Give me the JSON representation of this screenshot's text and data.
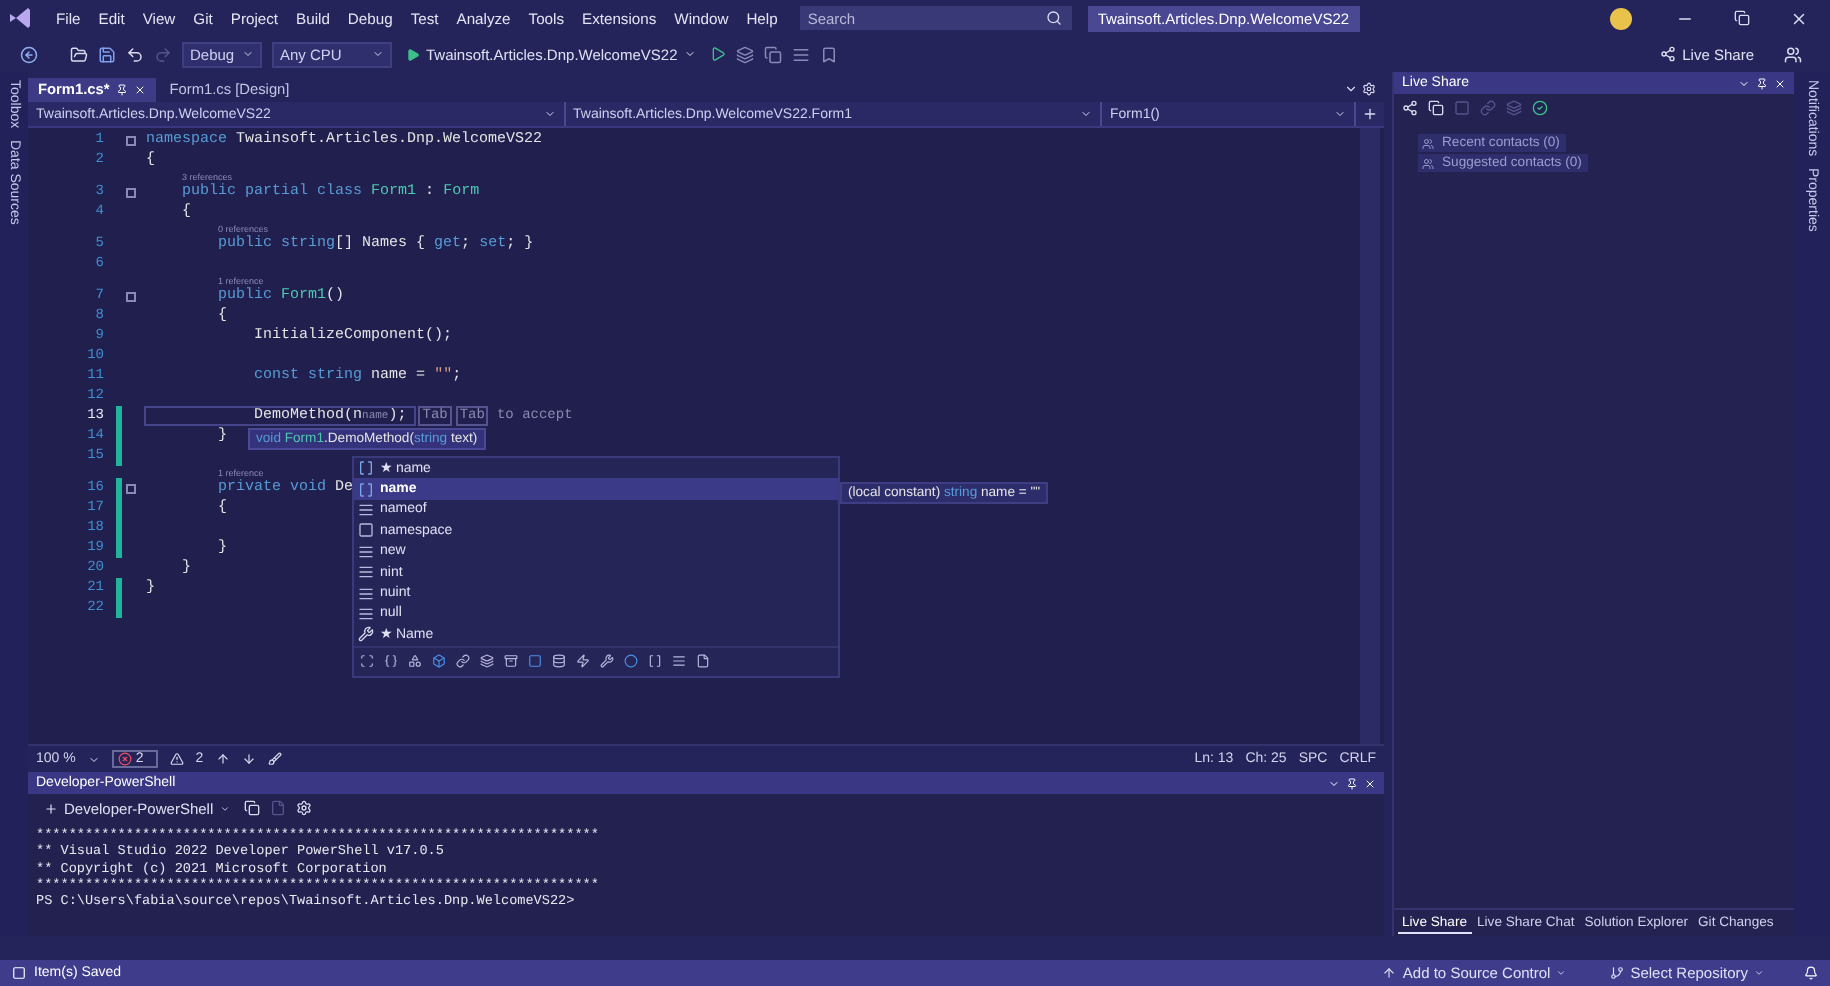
{
  "menu_bar": {
    "items": [
      "File",
      "Edit",
      "View",
      "Git",
      "Project",
      "Build",
      "Debug",
      "Test",
      "Analyze",
      "Tools",
      "Extensions",
      "Window",
      "Help"
    ],
    "search": {
      "placeholder": "Search"
    },
    "solution_name": "Twainsoft.Articles.Dnp.WelcomeVS22"
  },
  "toolbar": {
    "configuration": "Debug",
    "platform": "Any CPU",
    "start_target": "Twainsoft.Articles.Dnp.WelcomeVS22",
    "live_share": "Live Share"
  },
  "side_tabs_left": [
    "Toolbox",
    "Data Sources"
  ],
  "side_tabs_right": [
    "Notifications",
    "Properties"
  ],
  "document_tabs": [
    {
      "label": "Form1.cs*",
      "selected": true
    },
    {
      "label": "Form1.cs [Design]",
      "selected": false
    }
  ],
  "navigation_bar": [
    "Twainsoft.Articles.Dnp.WelcomeVS22",
    "Twainsoft.Articles.Dnp.WelcomeVS22.Form1",
    "Form1()"
  ],
  "code": {
    "lines": [
      {
        "number": "1",
        "collapsible": true,
        "changed": false,
        "current": false,
        "tokens": [
          {
            "text": "namespace",
            "kind": "keyword"
          },
          {
            "text": " Twainsoft.Articles.Dnp.WelcomeVS22",
            "kind": "plain"
          }
        ]
      },
      {
        "number": "2",
        "collapsible": false,
        "changed": false,
        "current": false,
        "tokens": [
          {
            "text": "{",
            "kind": "plain"
          }
        ]
      },
      {
        "number": "3",
        "lens": "3 references",
        "collapsible": true,
        "changed": false,
        "current": false,
        "tokens": [
          {
            "text": "    public partial class ",
            "kind": "keyword"
          },
          {
            "text": "Form1",
            "kind": "type"
          },
          {
            "text": " : ",
            "kind": "plain"
          },
          {
            "text": "Form",
            "kind": "type"
          }
        ]
      },
      {
        "number": "4",
        "collapsible": false,
        "changed": false,
        "current": false,
        "tokens": [
          {
            "text": "    {",
            "kind": "plain"
          }
        ]
      },
      {
        "number": "5",
        "lens": "0 references",
        "collapsible": false,
        "changed": false,
        "current": false,
        "tokens": [
          {
            "text": "        public string",
            "kind": "keyword"
          },
          {
            "text": "[] Names { ",
            "kind": "plain"
          },
          {
            "text": "get",
            "kind": "keyword"
          },
          {
            "text": "; ",
            "kind": "plain"
          },
          {
            "text": "set",
            "kind": "keyword"
          },
          {
            "text": "; }",
            "kind": "plain"
          }
        ]
      },
      {
        "number": "6",
        "collapsible": false,
        "changed": false,
        "current": false
      },
      {
        "number": "7",
        "lens": "1 reference",
        "collapsible": true,
        "changed": false,
        "current": false,
        "tokens": [
          {
            "text": "        public ",
            "kind": "keyword"
          },
          {
            "text": "Form1",
            "kind": "type"
          },
          {
            "text": "()",
            "kind": "plain"
          }
        ]
      },
      {
        "number": "8",
        "collapsible": false,
        "changed": false,
        "current": false,
        "tokens": [
          {
            "text": "        {",
            "kind": "plain"
          }
        ]
      },
      {
        "number": "9",
        "collapsible": false,
        "changed": false,
        "current": false,
        "tokens": [
          {
            "text": "            InitializeComponent();",
            "kind": "plain"
          }
        ]
      },
      {
        "number": "10",
        "collapsible": false,
        "changed": false,
        "current": false
      },
      {
        "number": "11",
        "collapsible": false,
        "changed": false,
        "current": false,
        "tokens": [
          {
            "text": "            const string ",
            "kind": "keyword"
          },
          {
            "text": "name",
            "kind": "plain"
          },
          {
            "text": " = ",
            "kind": "plain"
          },
          {
            "text": "\"\"",
            "kind": "string"
          },
          {
            "text": ";",
            "kind": "plain"
          }
        ]
      },
      {
        "number": "12",
        "collapsible": false,
        "changed": false,
        "current": false
      },
      {
        "number": "13",
        "collapsible": false,
        "changed": true,
        "current": true,
        "tokens": [
          {
            "text": "            DemoMethod(n",
            "kind": "plain"
          },
          {
            "text": "name",
            "kind": "ghost"
          },
          {
            "text": ");",
            "kind": "plain"
          }
        ],
        "hints": [
          {
            "text": "Tab",
            "kind": "key"
          },
          {
            "text": "Tab",
            "kind": "key"
          },
          {
            "text": "to accept",
            "kind": "note"
          }
        ]
      },
      {
        "number": "14",
        "collapsible": false,
        "changed": true,
        "current": false,
        "tokens": [
          {
            "text": "        }",
            "kind": "plain"
          }
        ]
      },
      {
        "number": "15",
        "collapsible": false,
        "changed": true,
        "current": false
      },
      {
        "number": "16",
        "lens": "1 reference",
        "collapsible": true,
        "changed": true,
        "current": false,
        "tokens": [
          {
            "text": "        private void ",
            "kind": "keyword"
          },
          {
            "text": "De",
            "kind": "plain"
          }
        ]
      },
      {
        "number": "17",
        "collapsible": false,
        "changed": true,
        "current": false,
        "tokens": [
          {
            "text": "        {",
            "kind": "plain"
          }
        ]
      },
      {
        "number": "18",
        "collapsible": false,
        "changed": true,
        "current": false
      },
      {
        "number": "19",
        "collapsible": false,
        "changed": true,
        "current": false,
        "tokens": [
          {
            "text": "        }",
            "kind": "plain"
          }
        ]
      },
      {
        "number": "20",
        "collapsible": false,
        "changed": false,
        "current": false,
        "tokens": [
          {
            "text": "    }",
            "kind": "plain"
          }
        ]
      },
      {
        "number": "21",
        "collapsible": false,
        "changed": true,
        "current": false,
        "tokens": [
          {
            "text": "}",
            "kind": "plain"
          }
        ]
      },
      {
        "number": "22",
        "collapsible": false,
        "changed": true,
        "current": false
      }
    ]
  },
  "signature_help": [
    {
      "text": "void ",
      "kind": "keyword"
    },
    {
      "text": "Form1",
      "kind": "type"
    },
    {
      "text": ".DemoMethod(",
      "kind": "plain"
    },
    {
      "text": "string",
      "kind": "keyword"
    },
    {
      "text": " text)",
      "kind": "plain"
    }
  ],
  "completion": {
    "items": [
      {
        "label": "★ name",
        "kind": "field",
        "selected": false
      },
      {
        "label": "name",
        "kind": "field",
        "selected": true
      },
      {
        "label": "nameof",
        "kind": "keyword",
        "selected": false
      },
      {
        "label": "namespace",
        "kind": "snippet",
        "selected": false
      },
      {
        "label": "new",
        "kind": "keyword",
        "selected": false
      },
      {
        "label": "nint",
        "kind": "keyword",
        "selected": false
      },
      {
        "label": "nuint",
        "kind": "keyword",
        "selected": false
      },
      {
        "label": "null",
        "kind": "keyword",
        "selected": false
      },
      {
        "label": "★ Name",
        "kind": "property",
        "selected": false
      }
    ],
    "tooltip": [
      {
        "text": "(local constant) ",
        "kind": "plain"
      },
      {
        "text": "string",
        "kind": "keyword"
      },
      {
        "text": " name = \"\"",
        "kind": "plain"
      }
    ]
  },
  "editor_status": {
    "zoom": "100 %",
    "errors": "2",
    "warnings": "2",
    "line": "Ln: 13",
    "column": "Ch: 25",
    "indent": "SPC",
    "line_ending": "CRLF"
  },
  "terminal": {
    "title": "Developer-PowerShell",
    "shell": "Developer-PowerShell",
    "lines": [
      "*********************************************************************",
      "** Visual Studio 2022 Developer PowerShell v17.0.5",
      "** Copyright (c) 2021 Microsoft Corporation",
      "*********************************************************************",
      "PS C:\\Users\\fabia\\source\\repos\\Twainsoft.Articles.Dnp.WelcomeVS22>"
    ]
  },
  "live_share": {
    "title": "Live Share",
    "contacts": [
      "Recent contacts (0)",
      "Suggested contacts (0)"
    ],
    "tabs": [
      {
        "label": "Live Share",
        "selected": true
      },
      {
        "label": "Live Share Chat",
        "selected": false
      },
      {
        "label": "Solution Explorer",
        "selected": false
      },
      {
        "label": "Git Changes",
        "selected": false
      }
    ]
  },
  "status_bar": {
    "message": "Item(s) Saved",
    "source_control": "Add to Source Control",
    "repository": "Select Repository"
  }
}
